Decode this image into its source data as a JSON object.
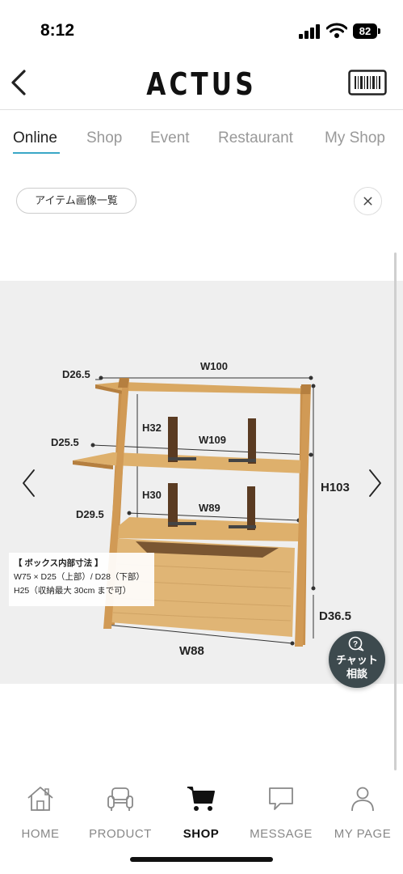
{
  "status_bar": {
    "time": "8:12",
    "battery": "82"
  },
  "header": {
    "logo": "ACTUS"
  },
  "tabs": [
    {
      "label": "Online"
    },
    {
      "label": "Shop"
    },
    {
      "label": "Event"
    },
    {
      "label": "Restaurant"
    },
    {
      "label": "My Shop"
    }
  ],
  "active_tab": "Online",
  "filter_chip": {
    "label": "アイテム画像一覧"
  },
  "product_image": {
    "dimensions": {
      "w100": "W100",
      "d26_5": "D26.5",
      "h32": "H32",
      "w109": "W109",
      "d25_5": "D25.5",
      "h30": "H30",
      "w89": "W89",
      "d29_5": "D29.5",
      "h103": "H103",
      "d36_5": "D36.5",
      "w88": "W88"
    },
    "box_note": {
      "title": "【 ボックス内部寸法 】",
      "line1": "W75 × D25（上部）/ D28（下部）",
      "line2": "H25（収納最大 30cm まで可）"
    }
  },
  "chat": {
    "line1": "チャット",
    "line2": "相談"
  },
  "bottom_nav": [
    {
      "label": "HOME",
      "icon": "home-icon"
    },
    {
      "label": "PRODUCT",
      "icon": "sofa-icon"
    },
    {
      "label": "SHOP",
      "icon": "cart-icon"
    },
    {
      "label": "MESSAGE",
      "icon": "speech-bubble-icon"
    },
    {
      "label": "MY PAGE",
      "icon": "person-icon"
    }
  ],
  "active_nav": "SHOP",
  "colors": {
    "accent": "#3aa7c7",
    "image_bg": "#efefef",
    "wood": "#d9a862",
    "chat_bg": "#3d4a4e"
  }
}
